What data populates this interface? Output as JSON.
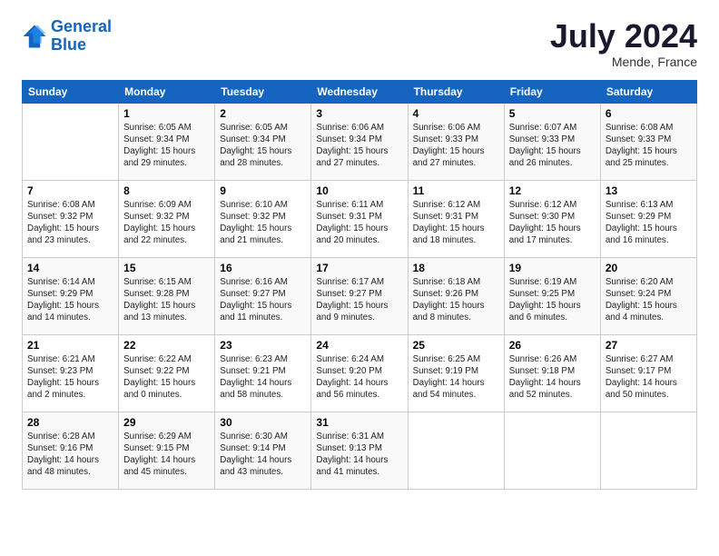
{
  "logo": {
    "line1": "General",
    "line2": "Blue"
  },
  "title": "July 2024",
  "subtitle": "Mende, France",
  "headers": [
    "Sunday",
    "Monday",
    "Tuesday",
    "Wednesday",
    "Thursday",
    "Friday",
    "Saturday"
  ],
  "weeks": [
    [
      {
        "day": "",
        "info": ""
      },
      {
        "day": "1",
        "info": "Sunrise: 6:05 AM\nSunset: 9:34 PM\nDaylight: 15 hours\nand 29 minutes."
      },
      {
        "day": "2",
        "info": "Sunrise: 6:05 AM\nSunset: 9:34 PM\nDaylight: 15 hours\nand 28 minutes."
      },
      {
        "day": "3",
        "info": "Sunrise: 6:06 AM\nSunset: 9:34 PM\nDaylight: 15 hours\nand 27 minutes."
      },
      {
        "day": "4",
        "info": "Sunrise: 6:06 AM\nSunset: 9:33 PM\nDaylight: 15 hours\nand 27 minutes."
      },
      {
        "day": "5",
        "info": "Sunrise: 6:07 AM\nSunset: 9:33 PM\nDaylight: 15 hours\nand 26 minutes."
      },
      {
        "day": "6",
        "info": "Sunrise: 6:08 AM\nSunset: 9:33 PM\nDaylight: 15 hours\nand 25 minutes."
      }
    ],
    [
      {
        "day": "7",
        "info": "Sunrise: 6:08 AM\nSunset: 9:32 PM\nDaylight: 15 hours\nand 23 minutes."
      },
      {
        "day": "8",
        "info": "Sunrise: 6:09 AM\nSunset: 9:32 PM\nDaylight: 15 hours\nand 22 minutes."
      },
      {
        "day": "9",
        "info": "Sunrise: 6:10 AM\nSunset: 9:32 PM\nDaylight: 15 hours\nand 21 minutes."
      },
      {
        "day": "10",
        "info": "Sunrise: 6:11 AM\nSunset: 9:31 PM\nDaylight: 15 hours\nand 20 minutes."
      },
      {
        "day": "11",
        "info": "Sunrise: 6:12 AM\nSunset: 9:31 PM\nDaylight: 15 hours\nand 18 minutes."
      },
      {
        "day": "12",
        "info": "Sunrise: 6:12 AM\nSunset: 9:30 PM\nDaylight: 15 hours\nand 17 minutes."
      },
      {
        "day": "13",
        "info": "Sunrise: 6:13 AM\nSunset: 9:29 PM\nDaylight: 15 hours\nand 16 minutes."
      }
    ],
    [
      {
        "day": "14",
        "info": "Sunrise: 6:14 AM\nSunset: 9:29 PM\nDaylight: 15 hours\nand 14 minutes."
      },
      {
        "day": "15",
        "info": "Sunrise: 6:15 AM\nSunset: 9:28 PM\nDaylight: 15 hours\nand 13 minutes."
      },
      {
        "day": "16",
        "info": "Sunrise: 6:16 AM\nSunset: 9:27 PM\nDaylight: 15 hours\nand 11 minutes."
      },
      {
        "day": "17",
        "info": "Sunrise: 6:17 AM\nSunset: 9:27 PM\nDaylight: 15 hours\nand 9 minutes."
      },
      {
        "day": "18",
        "info": "Sunrise: 6:18 AM\nSunset: 9:26 PM\nDaylight: 15 hours\nand 8 minutes."
      },
      {
        "day": "19",
        "info": "Sunrise: 6:19 AM\nSunset: 9:25 PM\nDaylight: 15 hours\nand 6 minutes."
      },
      {
        "day": "20",
        "info": "Sunrise: 6:20 AM\nSunset: 9:24 PM\nDaylight: 15 hours\nand 4 minutes."
      }
    ],
    [
      {
        "day": "21",
        "info": "Sunrise: 6:21 AM\nSunset: 9:23 PM\nDaylight: 15 hours\nand 2 minutes."
      },
      {
        "day": "22",
        "info": "Sunrise: 6:22 AM\nSunset: 9:22 PM\nDaylight: 15 hours\nand 0 minutes."
      },
      {
        "day": "23",
        "info": "Sunrise: 6:23 AM\nSunset: 9:21 PM\nDaylight: 14 hours\nand 58 minutes."
      },
      {
        "day": "24",
        "info": "Sunrise: 6:24 AM\nSunset: 9:20 PM\nDaylight: 14 hours\nand 56 minutes."
      },
      {
        "day": "25",
        "info": "Sunrise: 6:25 AM\nSunset: 9:19 PM\nDaylight: 14 hours\nand 54 minutes."
      },
      {
        "day": "26",
        "info": "Sunrise: 6:26 AM\nSunset: 9:18 PM\nDaylight: 14 hours\nand 52 minutes."
      },
      {
        "day": "27",
        "info": "Sunrise: 6:27 AM\nSunset: 9:17 PM\nDaylight: 14 hours\nand 50 minutes."
      }
    ],
    [
      {
        "day": "28",
        "info": "Sunrise: 6:28 AM\nSunset: 9:16 PM\nDaylight: 14 hours\nand 48 minutes."
      },
      {
        "day": "29",
        "info": "Sunrise: 6:29 AM\nSunset: 9:15 PM\nDaylight: 14 hours\nand 45 minutes."
      },
      {
        "day": "30",
        "info": "Sunrise: 6:30 AM\nSunset: 9:14 PM\nDaylight: 14 hours\nand 43 minutes."
      },
      {
        "day": "31",
        "info": "Sunrise: 6:31 AM\nSunset: 9:13 PM\nDaylight: 14 hours\nand 41 minutes."
      },
      {
        "day": "",
        "info": ""
      },
      {
        "day": "",
        "info": ""
      },
      {
        "day": "",
        "info": ""
      }
    ]
  ]
}
